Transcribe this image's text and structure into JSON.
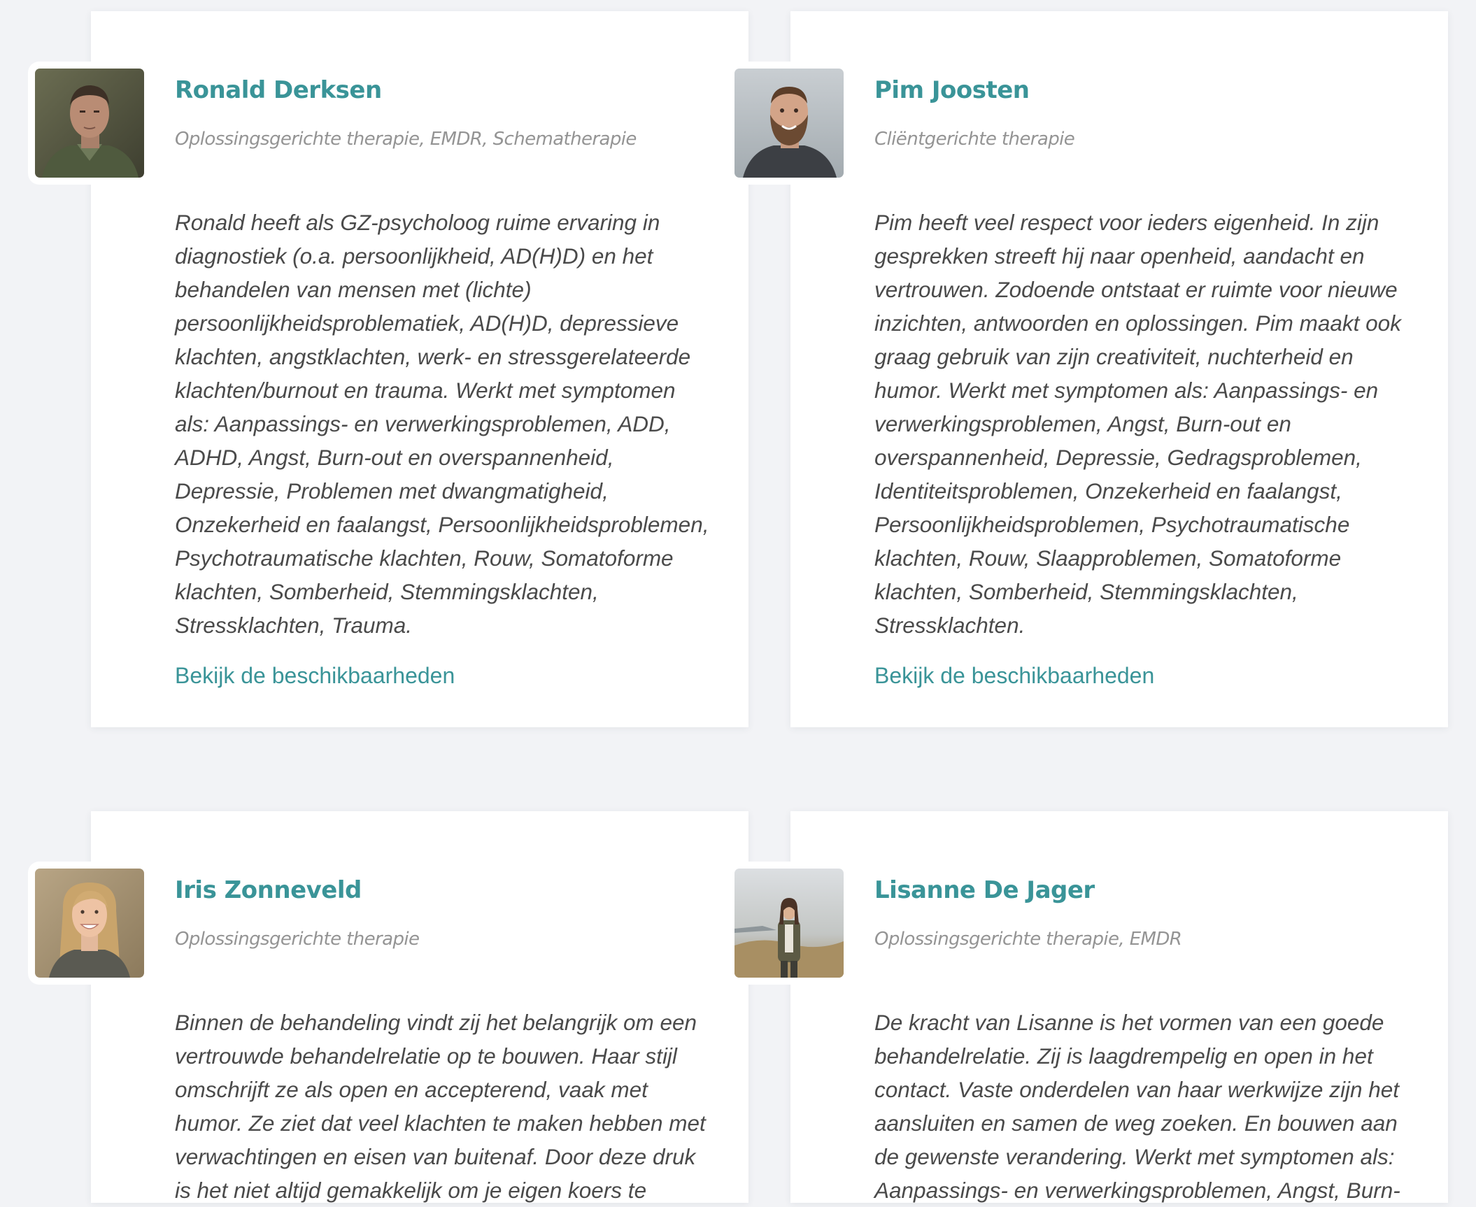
{
  "therapists": [
    {
      "name": "Ronald Derksen",
      "specialties": "Oplossingsgerichte therapie, EMDR, Schematherapie",
      "bio": "Ronald heeft als GZ-psycholoog ruime ervaring in diagnostiek (o.a. persoonlijkheid, AD(H)D) en het behandelen van mensen met (lichte) persoonlijkheidsproblematiek, AD(H)D, depressieve klachten, angstklachten, werk- en stressgerelateerde klachten/burnout en trauma. Werkt met symptomen als: Aanpassings- en verwerkingsproblemen, ADD, ADHD, Angst, Burn-out en overspannenheid, Depressie, Problemen met dwangmatigheid, Onzekerheid en faalangst, Persoonlijkheidsproblemen, Psychotraumatische klachten, Rouw, Somatoforme klachten, Somberheid, Stemmingsklachten, Stressklachten, Trauma.",
      "availability_link": "Bekijk de beschikbaarheden",
      "photo_icon": "portrait-man-jacket"
    },
    {
      "name": "Pim Joosten",
      "specialties": "Cliëntgerichte therapie",
      "bio": "Pim heeft veel respect voor ieders eigenheid. In zijn gesprekken streeft hij naar openheid, aandacht en vertrouwen. Zodoende ontstaat er ruimte voor nieuwe inzichten, antwoorden en oplossingen. Pim maakt ook graag gebruik van zijn creativiteit, nuchterheid en humor. Werkt met symptomen als: Aanpassings- en verwerkingsproblemen, Angst, Burn-out en overspannenheid, Depressie, Gedragsproblemen, Identiteitsproblemen, Onzekerheid en faalangst, Persoonlijkheidsproblemen, Psychotraumatische klachten, Rouw, Slaapproblemen, Somatoforme klachten, Somberheid, Stemmingsklachten, Stressklachten.",
      "availability_link": "Bekijk de beschikbaarheden",
      "photo_icon": "portrait-bearded-man"
    },
    {
      "name": "Iris Zonneveld",
      "specialties": "Oplossingsgerichte therapie",
      "bio": "Binnen de behandeling vindt zij het belangrijk om een vertrouwde behandelrelatie op te bouwen. Haar stijl omschrijft ze als open en accepterend, vaak met humor. Ze ziet dat veel klachten te maken hebben met verwachtingen en eisen van buitenaf. Door deze druk is het niet altijd gemakkelijk om je eigen koers te",
      "photo_icon": "portrait-blonde-woman"
    },
    {
      "name": "Lisanne De Jager",
      "specialties": "Oplossingsgerichte therapie, EMDR",
      "bio": "De kracht van Lisanne is het vormen van een goede behandelrelatie. Zij is laagdrempelig en open in het contact. Vaste onderdelen van haar werkwijze zijn het aansluiten en samen de weg zoeken. En bouwen aan de gewenste verandering. Werkt met symptomen als: Aanpassings- en verwerkingsproblemen, Angst, Burn-",
      "photo_icon": "portrait-woman-landscape"
    }
  ],
  "colors": {
    "accent": "#3a9498",
    "muted_text": "#949494",
    "body_text": "#4a4a4a",
    "page_background": "#f2f3f6"
  }
}
